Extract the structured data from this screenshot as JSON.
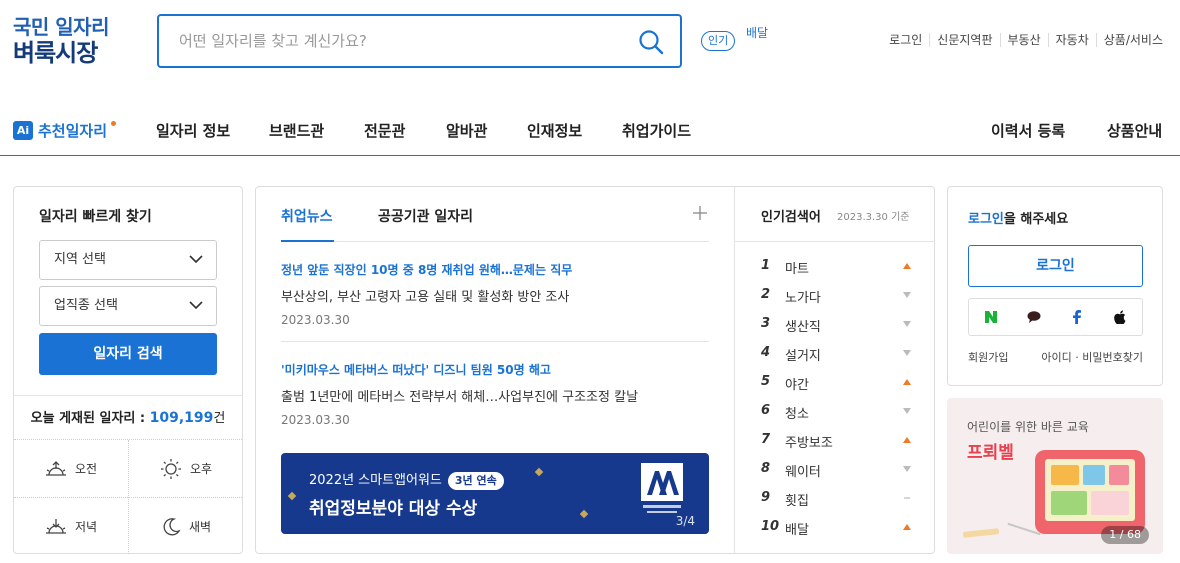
{
  "header": {
    "logo_line1": "국민 일자리",
    "logo_line2": "벼룩시장",
    "search_placeholder": "어떤 일자리를 찾고 계신가요?",
    "popular_badge": "인기",
    "popular_rolling": "배달",
    "top_links": [
      "로그인",
      "신문지역판",
      "부동산",
      "자동차",
      "상품/서비스"
    ]
  },
  "gnb": {
    "ai_icon_text": "Ai",
    "ai_label": "추천일자리",
    "items": [
      "일자리 정보",
      "브랜드관",
      "전문관",
      "알바관",
      "인재정보",
      "취업가이드"
    ],
    "right_items": [
      "이력서 등록",
      "상품안내"
    ]
  },
  "quick_search": {
    "title": "일자리 빠르게 찾기",
    "region_select": "지역 선택",
    "industry_select": "업직종 선택",
    "search_button": "일자리 검색",
    "today_label": "오늘 게재된 일자리 : ",
    "today_count": "109,199",
    "today_unit": "건",
    "shifts": [
      "오전",
      "오후",
      "저녁",
      "새벽"
    ]
  },
  "news": {
    "tabs": [
      "취업뉴스",
      "공공기관 일자리"
    ],
    "items": [
      {
        "headline": "정년 앞둔 직장인 10명 중 8명 재취업 원해…문제는 직무",
        "summary": "부산상의, 부산 고령자 고용 실태 및 활성화 방안 조사",
        "date": "2023.03.30"
      },
      {
        "headline": "'미키마우스 메타버스 떠났다' 디즈니 팀원 50명 해고",
        "summary": "출범 1년만에 메타버스 전략부서 해체…사업부진에 구조조정 칼날",
        "date": "2023.03.30"
      }
    ],
    "banner": {
      "line1": "2022년 스마트앱어워드",
      "badge": "3년 연속",
      "line2": "취업정보분야 대상 수상",
      "pager": "3/4"
    }
  },
  "popular": {
    "title": "인기검색어",
    "date": "2023.3.30 기준",
    "keywords": [
      {
        "rank": "1",
        "name": "마트",
        "trend": "up"
      },
      {
        "rank": "2",
        "name": "노가다",
        "trend": "down"
      },
      {
        "rank": "3",
        "name": "생산직",
        "trend": "down"
      },
      {
        "rank": "4",
        "name": "설거지",
        "trend": "down"
      },
      {
        "rank": "5",
        "name": "야간",
        "trend": "up"
      },
      {
        "rank": "6",
        "name": "청소",
        "trend": "down"
      },
      {
        "rank": "7",
        "name": "주방보조",
        "trend": "up"
      },
      {
        "rank": "8",
        "name": "웨이터",
        "trend": "down"
      },
      {
        "rank": "9",
        "name": "횟집",
        "trend": "same"
      },
      {
        "rank": "10",
        "name": "배달",
        "trend": "up"
      }
    ]
  },
  "login": {
    "msg_em": "로그인",
    "msg_rest": "을 해주세요",
    "button": "로그인",
    "signup": "회원가입",
    "find": "아이디 · 비밀번호찾기"
  },
  "ad": {
    "line1": "어린이를 위한 바른 교육",
    "line2": "프뢰벨",
    "pager": "1 / 68"
  },
  "colors": {
    "primary": "#1a73d4",
    "up": "#f07a23",
    "down": "#bbbbbb",
    "banner": "#16398e"
  }
}
